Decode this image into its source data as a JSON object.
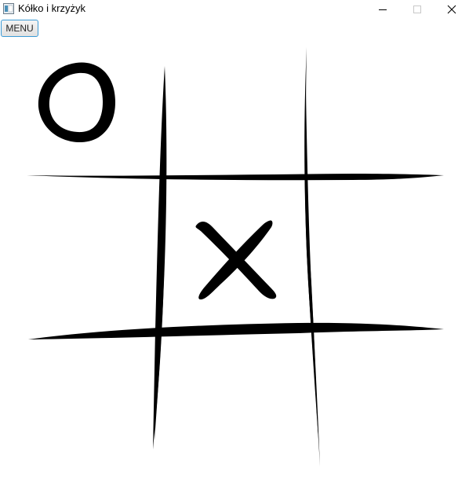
{
  "window": {
    "title": "Kółko i krzyżyk",
    "controls": {
      "minimize": "minimize-icon",
      "maximize": "maximize-icon",
      "close": "close-icon"
    }
  },
  "toolbar": {
    "menu_label": "MENU"
  },
  "board": {
    "rows": 3,
    "cols": 3,
    "cells": [
      "O",
      "",
      "",
      "",
      "X",
      "",
      "",
      "",
      ""
    ],
    "ink_color": "#000000",
    "background": "#ffffff"
  },
  "colors": {
    "menu_border": "#3c9bd6"
  }
}
